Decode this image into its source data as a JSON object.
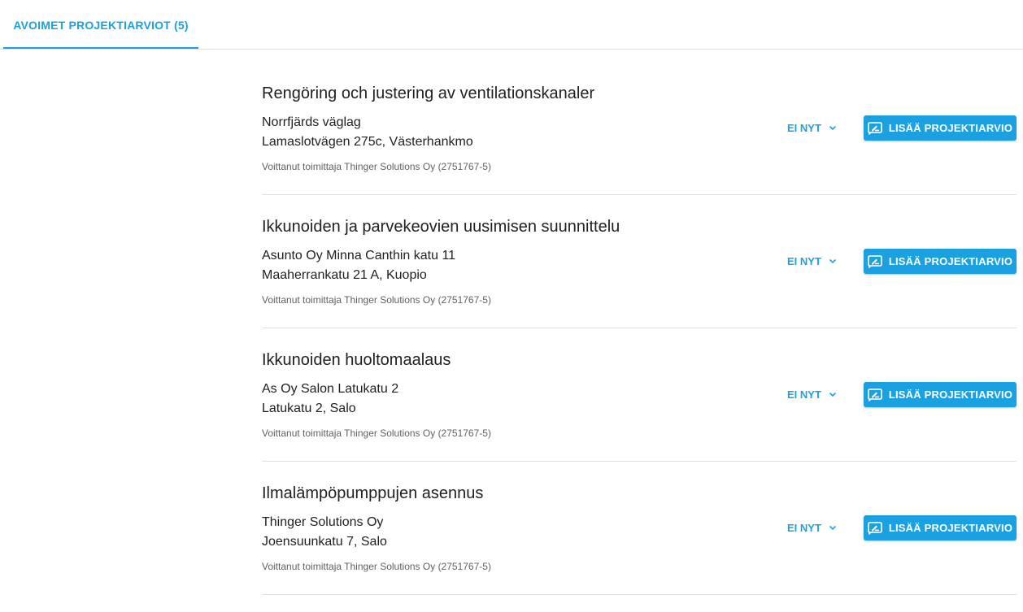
{
  "tabs": [
    {
      "label": "AVOIMET PROJEKTIARVIOT (5)",
      "active": true
    }
  ],
  "accent_color": "#1ba1e2",
  "projects": [
    {
      "title": "Rengöring och justering av ventilationskanaler",
      "organization": "Norrfjärds väglag",
      "address": "Lamaslotvägen 275c, Västerhankmo",
      "winner": "Voittanut toimittaja Thinger Solutions Oy (2751767-5)",
      "dismiss_label": "EI NYT",
      "add_label": "LISÄÄ PROJEKTIARVIO"
    },
    {
      "title": "Ikkunoiden ja parvekeovien uusimisen suunnittelu",
      "organization": "Asunto Oy Minna Canthin katu 11",
      "address": "Maaherrankatu 21 A, Kuopio",
      "winner": "Voittanut toimittaja Thinger Solutions Oy (2751767-5)",
      "dismiss_label": "EI NYT",
      "add_label": "LISÄÄ PROJEKTIARVIO"
    },
    {
      "title": "Ikkunoiden huoltomaalaus",
      "organization": "As Oy Salon Latukatu 2",
      "address": "Latukatu 2, Salo",
      "winner": "Voittanut toimittaja Thinger Solutions Oy (2751767-5)",
      "dismiss_label": "EI NYT",
      "add_label": "LISÄÄ PROJEKTIARVIO"
    },
    {
      "title": "Ilmalämpöpumppujen asennus",
      "organization": "Thinger Solutions Oy",
      "address": "Joensuunkatu 7, Salo",
      "winner": "Voittanut toimittaja Thinger Solutions Oy (2751767-5)",
      "dismiss_label": "EI NYT",
      "add_label": "LISÄÄ PROJEKTIARVIO"
    }
  ],
  "icons": {
    "dismiss": "chevron-down-icon",
    "add": "rate-review-icon"
  }
}
